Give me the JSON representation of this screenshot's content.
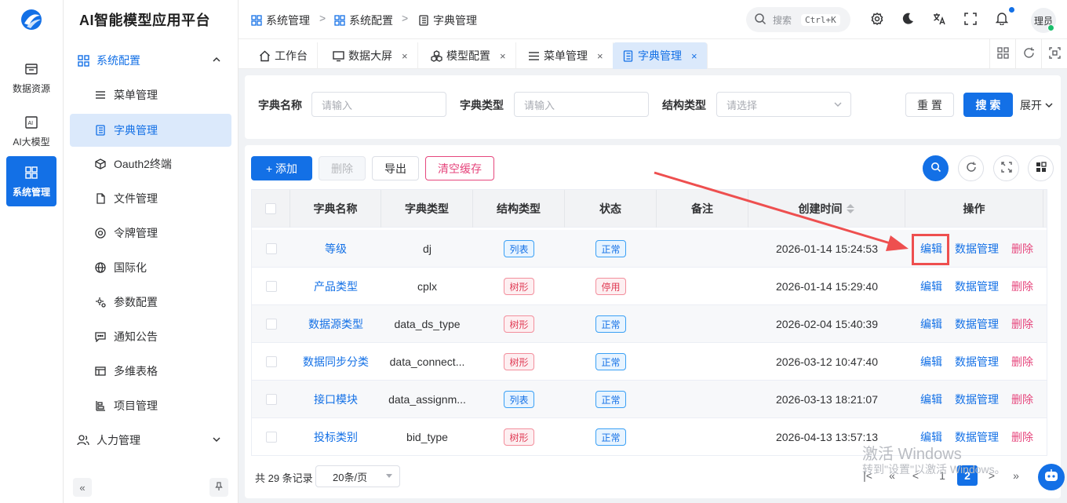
{
  "rail": {
    "items": [
      {
        "label": "数据资源",
        "icon": "database-table-icon"
      },
      {
        "label": "AI大模型",
        "icon": "ai-chip-icon"
      },
      {
        "label": "系统管理",
        "icon": "system-grid-icon"
      }
    ]
  },
  "app": {
    "title": "AI智能模型应用平台"
  },
  "menu": {
    "group1": {
      "label": "系统配置"
    },
    "items": [
      {
        "label": "菜单管理"
      },
      {
        "label": "字典管理"
      },
      {
        "label": "Oauth2终端"
      },
      {
        "label": "文件管理"
      },
      {
        "label": "令牌管理"
      },
      {
        "label": "国际化"
      },
      {
        "label": "参数配置"
      },
      {
        "label": "通知公告"
      },
      {
        "label": "多维表格"
      },
      {
        "label": "项目管理"
      }
    ],
    "group2": {
      "label": "人力管理"
    },
    "collapse_label": "«"
  },
  "breadcrumb": {
    "items": [
      "系统管理",
      "系统配置",
      "字典管理"
    ],
    "sep": ">"
  },
  "header": {
    "search_placeholder": "搜索",
    "shortcut": "Ctrl+K",
    "user": "理员"
  },
  "tabs": [
    {
      "label": "工作台",
      "closable": false
    },
    {
      "label": "数据大屏",
      "closable": true
    },
    {
      "label": "模型配置",
      "closable": true
    },
    {
      "label": "菜单管理",
      "closable": true
    },
    {
      "label": "字典管理",
      "closable": true
    }
  ],
  "tab_close": "×",
  "filter": {
    "name_label": "字典名称",
    "name_placeholder": "请输入",
    "type_label": "字典类型",
    "type_placeholder": "请输入",
    "struct_label": "结构类型",
    "struct_placeholder": "请选择",
    "reset": "重 置",
    "search": "搜 索",
    "expand": "展开"
  },
  "toolbar": {
    "add": "+ 添加",
    "delete": "删除",
    "export": "导出",
    "clear_cache": "清空缓存"
  },
  "table": {
    "columns": [
      "字典名称",
      "字典类型",
      "结构类型",
      "状态",
      "备注",
      "创建时间",
      "操作"
    ],
    "actions": {
      "edit": "编辑",
      "data": "数据管理",
      "delete": "删除"
    },
    "rows": [
      {
        "name": "等级",
        "type": "dj",
        "struct": "列表",
        "status": "正常",
        "remark": "",
        "created": "2026-01-14 15:24:53"
      },
      {
        "name": "产品类型",
        "type": "cplx",
        "struct": "树形",
        "status": "停用",
        "remark": "",
        "created": "2026-01-14 15:29:40"
      },
      {
        "name": "数据源类型",
        "type": "data_ds_type",
        "struct": "树形",
        "status": "正常",
        "remark": "",
        "created": "2026-02-04 15:40:39"
      },
      {
        "name": "数据同步分类",
        "type": "data_connect...",
        "struct": "树形",
        "status": "正常",
        "remark": "",
        "created": "2026-03-12 10:47:40"
      },
      {
        "name": "接口模块",
        "type": "data_assignm...",
        "struct": "列表",
        "status": "正常",
        "remark": "",
        "created": "2026-03-13 18:21:07"
      },
      {
        "name": "投标类别",
        "type": "bid_type",
        "struct": "树形",
        "status": "正常",
        "remark": "",
        "created": "2026-04-13 13:57:13"
      }
    ]
  },
  "pagination": {
    "total": "共 29 条记录",
    "page_size": "20条/页",
    "first": "|<",
    "prev_more": "«",
    "prev": "<",
    "pages": [
      "1",
      "2"
    ],
    "current": "2",
    "next": ">",
    "next_more": "»"
  },
  "watermark": {
    "line1": "激活 Windows",
    "line2": "转到\"设置\"以激活 Windows。"
  },
  "colors": {
    "primary": "#1370e6",
    "danger": "#e6477d",
    "annotation": "#ee4f4f"
  }
}
